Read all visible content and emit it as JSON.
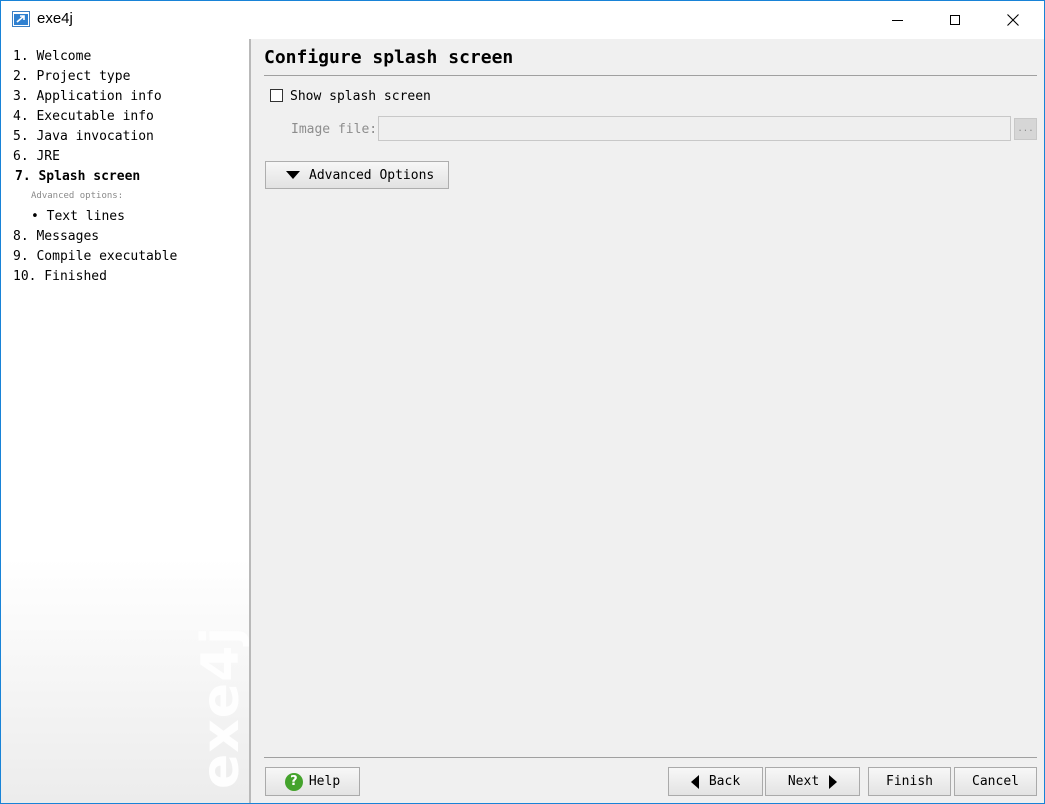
{
  "window": {
    "title": "exe4j"
  },
  "sidebar": {
    "steps": [
      {
        "label": "1. Welcome"
      },
      {
        "label": "2. Project type"
      },
      {
        "label": "3. Application info"
      },
      {
        "label": "4. Executable info"
      },
      {
        "label": "5. Java invocation"
      },
      {
        "label": "6. JRE"
      },
      {
        "label": "7. Splash screen",
        "active": true
      },
      {
        "label": "8. Messages"
      },
      {
        "label": "9. Compile executable"
      },
      {
        "label": "10. Finished"
      }
    ],
    "advanced_options_label": "Advanced options:",
    "sub_items": [
      {
        "label": "• Text lines"
      }
    ],
    "watermark": "exe4j"
  },
  "main": {
    "title": "Configure splash screen",
    "show_splash_label": "Show splash screen",
    "show_splash_checked": false,
    "image_file_label": "Image file:",
    "image_file_value": "",
    "browse_label": "...",
    "advanced_button_label": "Advanced Options"
  },
  "footer": {
    "help_label": "Help",
    "back_label": "Back",
    "next_label": "Next",
    "finish_label": "Finish",
    "cancel_label": "Cancel"
  },
  "colors": {
    "accent_border": "#1883d7",
    "help_icon": "#44a32c"
  }
}
